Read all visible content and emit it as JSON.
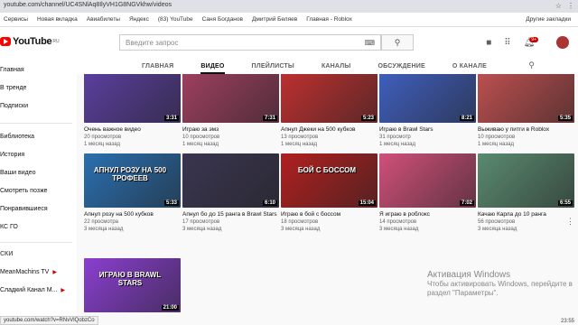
{
  "browser": {
    "url": "youtube.com/channel/UC4SNlAq8IlyVH1G8NGVkhw/videos",
    "bookmarks": [
      "Сервисы",
      "Новая вкладка",
      "Авиабилеты",
      "Яндекс",
      "(83) YouTube",
      "Саня Богданов",
      "Дмитрий Беляев",
      "Главная - Roblox"
    ],
    "other_bookmarks": "Другие закладки",
    "status_url": "youtube.com/watch?v=RNvVlQobzCo",
    "time": "23:55"
  },
  "youtube": {
    "logo": "YouTube",
    "logo_region": "RU",
    "search_placeholder": "Введите запрос",
    "notification_count": "9+"
  },
  "tabs": [
    "ГЛАВНАЯ",
    "ВИДЕО",
    "ПЛЕЙЛИСТЫ",
    "КАНАЛЫ",
    "ОБСУЖДЕНИЕ",
    "О КАНАЛЕ"
  ],
  "sidebar": {
    "items": [
      "Главная",
      "В тренде",
      "Подписки",
      "Библиотека",
      "История",
      "Ваши видео",
      "Смотреть позже",
      "Понравившиеся",
      "КС ГО"
    ],
    "section": "СКИ",
    "subs": [
      {
        "name": "MeanMachins TV",
        "live": true
      },
      {
        "name": "Сладкий Канал М...",
        "live": true
      }
    ]
  },
  "videos": [
    {
      "title": "Очень важное видео",
      "views": "20 просмотров",
      "age": "1 месяц назад",
      "duration": "3:31",
      "color": "#5b3fa0"
    },
    {
      "title": "Играю за эмз",
      "views": "10 просмотров",
      "age": "1 месяц назад",
      "duration": "7:31",
      "color": "#a04060"
    },
    {
      "title": "Апнул Джеки на 500 кубков",
      "views": "13 просмотров",
      "age": "1 месяц назад",
      "duration": "5:23",
      "color": "#c03030"
    },
    {
      "title": "Играю в Brawl Stars",
      "views": "31 просмотр",
      "age": "1 месяц назад",
      "duration": "8:21",
      "color": "#4060c0"
    },
    {
      "title": "Выживаю у питги в Roblox",
      "views": "10 просмотров",
      "age": "1 месяц назад",
      "duration": "5:35",
      "color": "#c05050"
    },
    {
      "title": "Апнул розу на 500 кубков",
      "views": "22 просмотра",
      "age": "3 месяца назад",
      "duration": "5:33",
      "color": "#2a6fb0"
    },
    {
      "title": "Апнул бо до 15 ранга в Brawl Stars",
      "views": "17 просмотров",
      "age": "3 месяца назад",
      "duration": "6:10",
      "color": "#3a3550"
    },
    {
      "title": "Играю в бой с боссом",
      "views": "18 просмотров",
      "age": "3 месяца назад",
      "duration": "15:04",
      "color": "#b02020"
    },
    {
      "title": "Я играю в роблокс",
      "views": "14 просмотров",
      "age": "3 месяца назад",
      "duration": "7:02",
      "color": "#d0507a"
    },
    {
      "title": "Качаю Карла до 10 ранга",
      "views": "56 просмотров",
      "age": "3 месяца назад",
      "duration": "6:55",
      "color": "#5a8a70"
    },
    {
      "title": "",
      "views": "",
      "age": "",
      "duration": "21:00",
      "color": "#8a3fd0"
    }
  ],
  "thumb_texts": {
    "v6": "АПНУЛ РОЗУ НА 500 ТРОФЕЕВ",
    "v8": "БОЙ С БОССОМ",
    "v11": "ИГРАЮ В BRAWL STARS"
  },
  "windows": {
    "activate_title": "Активация Windows",
    "activate_text_1": "Чтобы активировать Windows, перейдите в",
    "activate_text_2": "раздел \"Параметры\"."
  }
}
